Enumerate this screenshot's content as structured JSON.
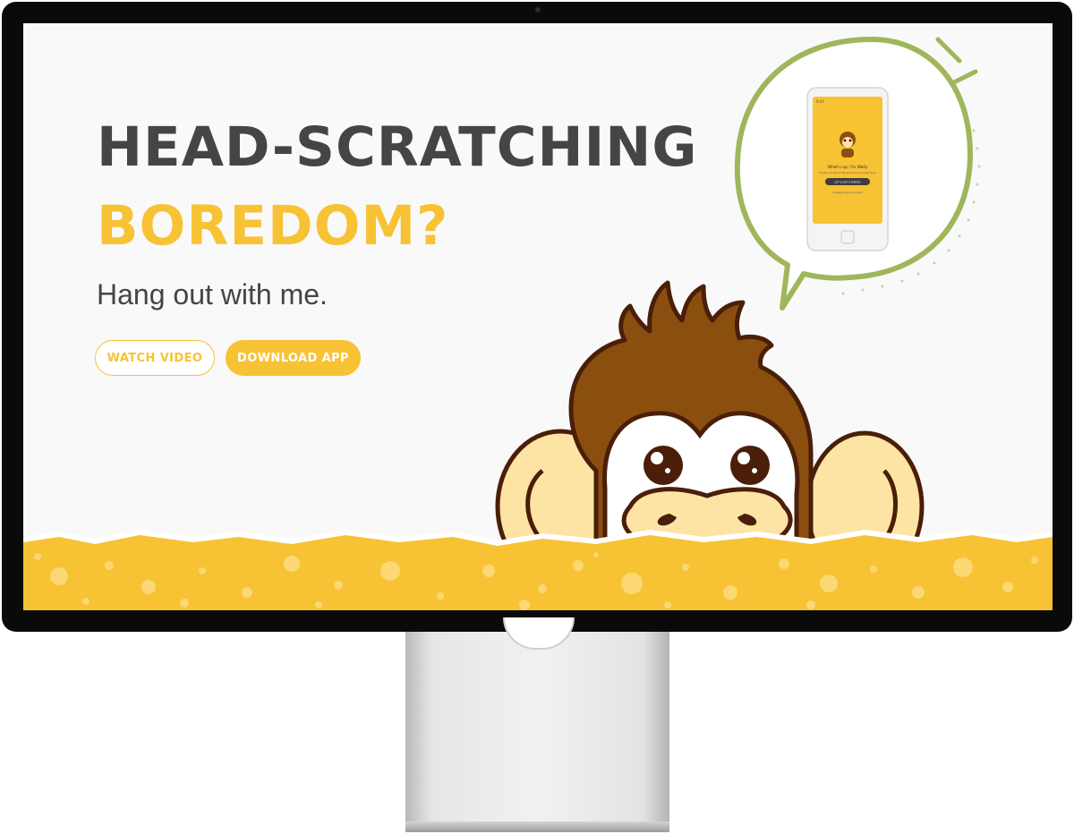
{
  "hero": {
    "headline_line1": "HEAD-SCRATCHING",
    "headline_line2": "BOREDOM?",
    "subheadline": "Hang out with me."
  },
  "buttons": {
    "watch_video": "WATCH VIDEO",
    "download_app": "DOWNLOAD APP"
  },
  "phone_screen": {
    "status_time": "9:41",
    "greeting": "What's up, I'm Wally",
    "tagline": "I'll help you find all the places you are able to go",
    "cta": "LET'S GET STARTED",
    "footer": "I already have an account"
  },
  "colors": {
    "accent": "#f7c234",
    "text_dark": "#454545",
    "bubble_green": "#9fb65a",
    "monkey_brown": "#8a4f0f",
    "monkey_face": "#fde4a4"
  },
  "icons": [
    "speech-bubble-icon",
    "monkey-mascot-icon",
    "phone-mockup-icon"
  ]
}
